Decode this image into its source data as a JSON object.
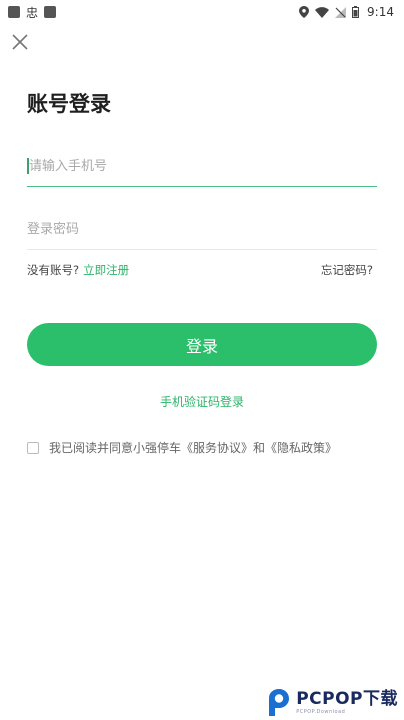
{
  "status_bar": {
    "carrier_glyph": "忠",
    "time": "9:14"
  },
  "header": {
    "title": "账号登录"
  },
  "form": {
    "phone_placeholder": "请输入手机号",
    "password_placeholder": "登录密码",
    "no_account_text": "没有账号?",
    "register_label": "立即注册",
    "forgot_label": "忘记密码?",
    "login_button_label": "登录",
    "sms_login_label": "手机验证码登录",
    "agreement_text": "我已阅读并同意小强停车《服务协议》和《隐私政策》"
  },
  "watermark": {
    "main": "PCPOP下载",
    "sub": "PCPOP.Download"
  },
  "colors": {
    "accent": "#2bbf6b",
    "link": "#2db368",
    "underline_active": "#4cbf88"
  }
}
